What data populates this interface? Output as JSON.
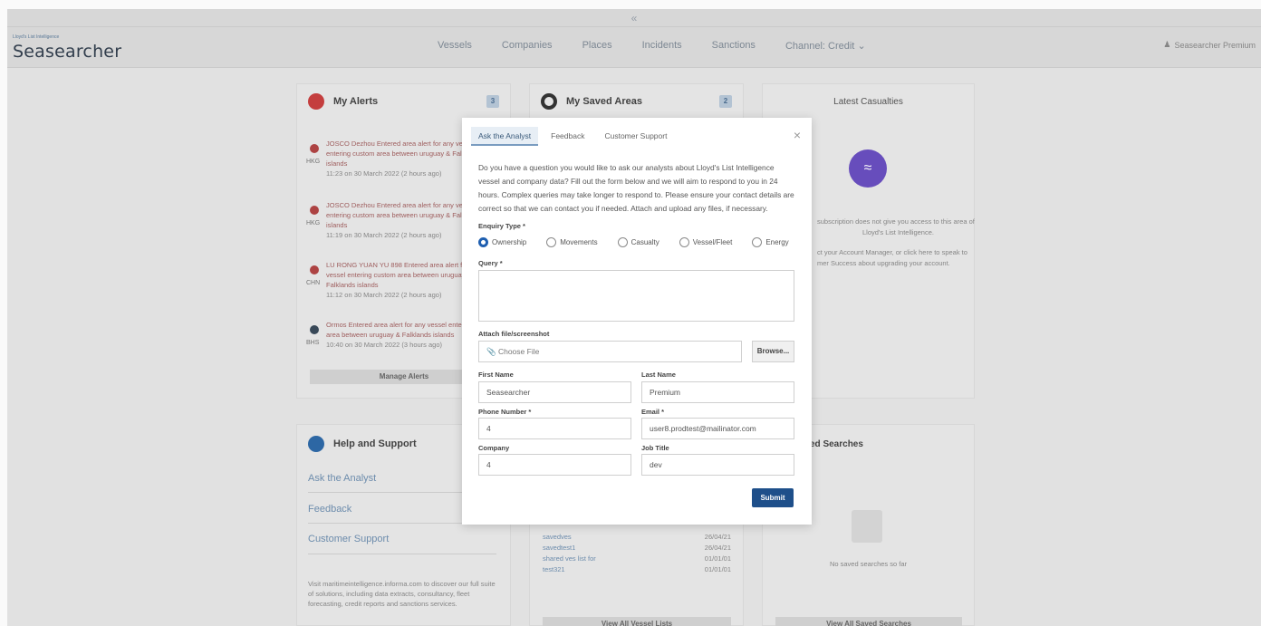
{
  "app": {
    "logo_small": "Lloyd's List Intelligence",
    "logo": "Seasearcher",
    "chevron": "«",
    "user": "Seasearcher Premium",
    "nav": [
      "Vessels",
      "Companies",
      "Places",
      "Incidents",
      "Sanctions",
      "Channel: Credit"
    ]
  },
  "alerts": {
    "title": "My Alerts",
    "count": "3",
    "items": [
      {
        "text": "JOSCO Dezhou Entered area alert for any vessel entering custom area between uruguay & Falklands islands",
        "time": "11:23 on 30 March 2022 (2 hours ago)",
        "cc": "HKG"
      },
      {
        "text": "JOSCO Dezhou Entered area alert for any vessel entering custom area between uruguay & Falklands islands",
        "time": "11:19 on 30 March 2022 (2 hours ago)",
        "cc": "HKG"
      },
      {
        "text": "LU RONG YUAN YU 898 Entered area alert for any vessel entering custom area between uruguay & Falklands islands",
        "time": "11:12 on 30 March 2022 (2 hours ago)",
        "cc": "CHN"
      },
      {
        "text": "Ormos Entered area alert for any vessel entering custom area between uruguay & Falklands islands",
        "time": "10:40 on 30 March 2022 (3 hours ago)",
        "cc": "BHS"
      }
    ],
    "manage": "Manage Alerts"
  },
  "saved_areas": {
    "title": "My Saved Areas",
    "count": "2"
  },
  "casualties": {
    "title": "Latest Casualties",
    "line1": "subscription does not give you access to this area of",
    "line2": "Lloyd's List Intelligence.",
    "line3": "ct your Account Manager, or click here to speak to",
    "line4": "mer Success about upgrading your account."
  },
  "help": {
    "title": "Help and Support",
    "links": [
      "Ask the Analyst",
      "Feedback",
      "Customer Support"
    ],
    "footer": "Visit maritimeintelligence.informa.com to discover our full suite of solutions, including data extracts, consultancy, fleet forecasting, credit reports and sanctions services."
  },
  "vessel_lists": {
    "rows": [
      {
        "name": "savedves",
        "date": "26/04/21"
      },
      {
        "name": "savedtest1",
        "date": "26/04/21"
      },
      {
        "name": "shared ves list for",
        "date": "01/01/01"
      },
      {
        "name": "test321",
        "date": "01/01/01"
      }
    ],
    "view_all": "View All Vessel Lists"
  },
  "saved_searches": {
    "title": "ed Searches",
    "empty": "No saved searches so far",
    "view_all": "View All Saved Searches"
  },
  "modal": {
    "tabs": [
      "Ask the Analyst",
      "Feedback",
      "Customer Support"
    ],
    "close": "×",
    "intro": "Do you have a question you would like to ask our analysts about Lloyd's List Intelligence vessel and company data? Fill out the form below and we will aim to respond to you in 24 hours. Complex queries may take longer to respond to. Please ensure your contact details are correct so that we can contact you if needed. Attach and upload any files, if necessary.",
    "enquiry_label": "Enquiry Type *",
    "enquiry_options": [
      "Ownership",
      "Movements",
      "Casualty",
      "Vessel/Fleet",
      "Energy"
    ],
    "enquiry_selected": "Ownership",
    "query_label": "Query *",
    "attach_label": "Attach file/screenshot",
    "choose_file": "Choose File",
    "browse": "Browse...",
    "first_name_label": "First Name",
    "first_name": "Seasearcher",
    "last_name_label": "Last Name",
    "last_name": "Premium",
    "phone_label": "Phone Number *",
    "phone": "4",
    "email_label": "Email *",
    "email": "user8.prodtest@mailinator.com",
    "company_label": "Company",
    "company": "4",
    "job_title_label": "Job Title",
    "job_title": "dev",
    "submit": "Submit"
  },
  "colors": {
    "accent": "#1e4f8a",
    "alerts_icon": "#c84040",
    "casualty_icon": "#6a4fc0"
  }
}
